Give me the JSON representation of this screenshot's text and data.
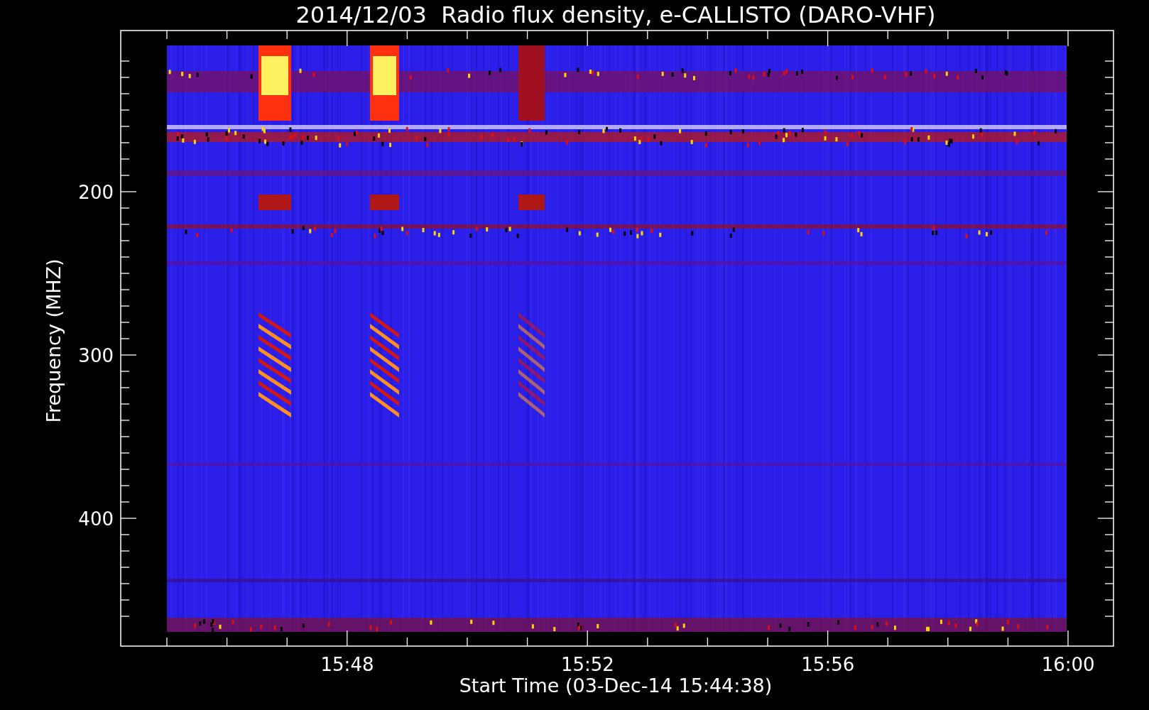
{
  "title": "2014/12/03  Radio flux density, e-CALLISTO (DARO-VHF)",
  "y_axis": {
    "label": "Frequency (MHZ)",
    "ticks": [
      "200",
      "300",
      "400"
    ]
  },
  "x_axis": {
    "label": "Start Time (03-Dec-14 15:44:38)",
    "ticks": [
      "15:48",
      "15:52",
      "15:56",
      "16:00"
    ]
  }
}
